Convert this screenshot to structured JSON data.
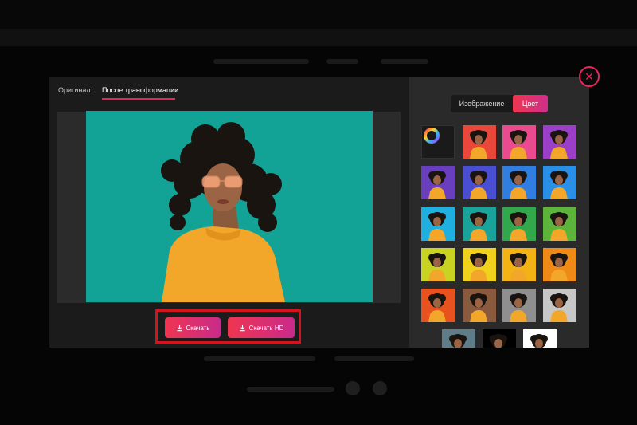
{
  "tabs": [
    {
      "label": "Оригинал",
      "active": false
    },
    {
      "label": "После трансформации",
      "active": true
    }
  ],
  "segmented": {
    "image_label": "Изображение",
    "color_label": "Цвет",
    "selected": "Цвет"
  },
  "buttons": {
    "download_label": "Скачать",
    "download_hd_label": "Скачать HD"
  },
  "close_icon": "close-icon",
  "accent_color": "#e8265d",
  "photo_background": "#13a396",
  "swatches": [
    {
      "type": "color-wheel",
      "icon": "color-wheel-icon"
    },
    {
      "color": "#e9473a"
    },
    {
      "color": "#e94b8e"
    },
    {
      "color": "#9b3fc9"
    },
    {
      "color": "#6a3fbf"
    },
    {
      "color": "#4a4ed1"
    },
    {
      "color": "#2f7ee0"
    },
    {
      "color": "#2a8fe6"
    },
    {
      "color": "#1fb0e0"
    },
    {
      "color": "#1aa39a"
    },
    {
      "color": "#31a84c"
    },
    {
      "color": "#5cb53a"
    },
    {
      "color": "#c9d321"
    },
    {
      "color": "#f0d21c"
    },
    {
      "color": "#f4b315"
    },
    {
      "color": "#f08a17"
    },
    {
      "color": "#e8521e"
    },
    {
      "color": "#8a5a3e"
    },
    {
      "color": "#8f8f8f"
    },
    {
      "color": "#c7c7c7"
    },
    {
      "color": "#5f7d88"
    },
    {
      "color": "#000000"
    },
    {
      "color": "#ffffff"
    }
  ]
}
